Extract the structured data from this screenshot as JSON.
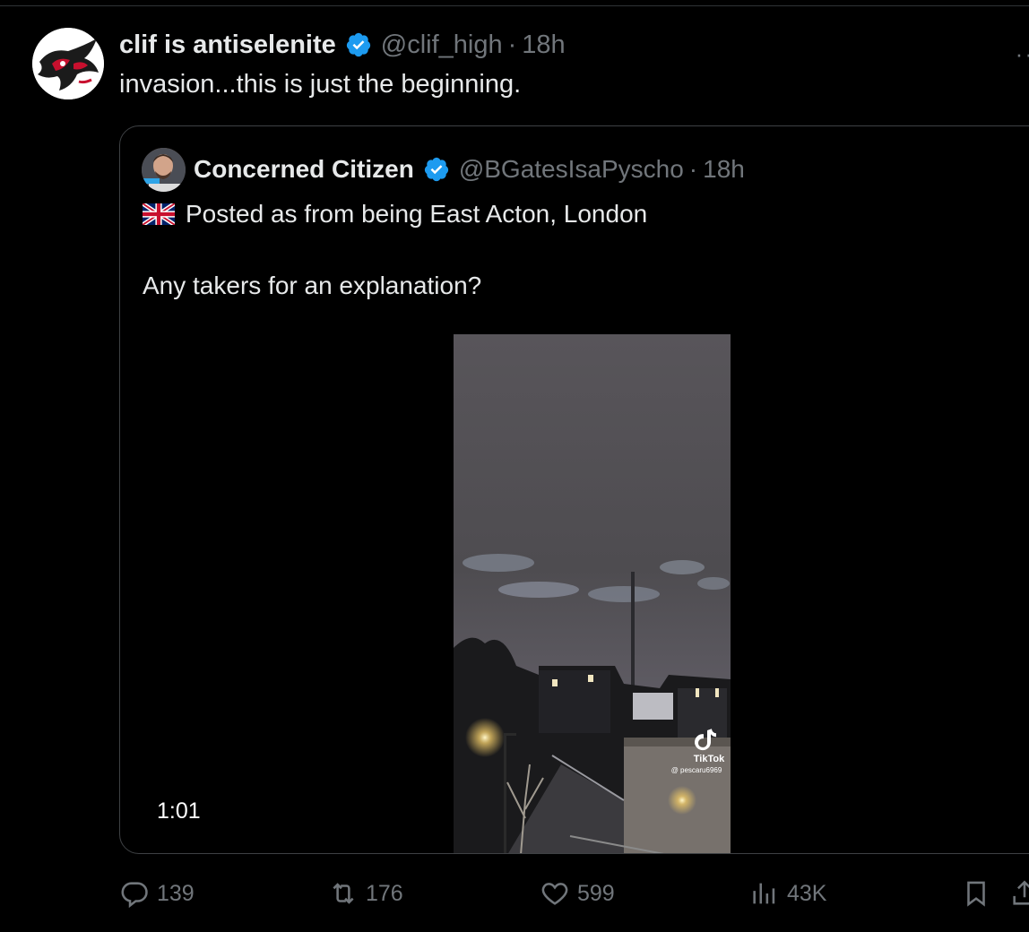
{
  "tweet": {
    "author_name": "clif is antiselenite",
    "handle": "@clif_high",
    "separator": "·",
    "time": "18h",
    "text": "invasion...this is just the beginning.",
    "more": "··"
  },
  "quoted_tweet": {
    "author_name": "Concerned Citizen",
    "handle": "@BGatesIsaPyscho",
    "separator": "·",
    "time": "18h",
    "flag_icon": "uk-flag-icon",
    "line1": "Posted as from being East Acton, London",
    "line2": "Any takers for an explanation?",
    "video": {
      "duration": "1:01",
      "watermark_brand": "TikTok",
      "watermark_handle": "@ pescaru6969"
    }
  },
  "actions": {
    "replies": "139",
    "reposts": "176",
    "likes": "599",
    "views": "43K"
  },
  "colors": {
    "background": "#000000",
    "text": "#e7e9ea",
    "muted": "#71767b",
    "verified": "#1d9bf0",
    "border": "#3e4144"
  }
}
